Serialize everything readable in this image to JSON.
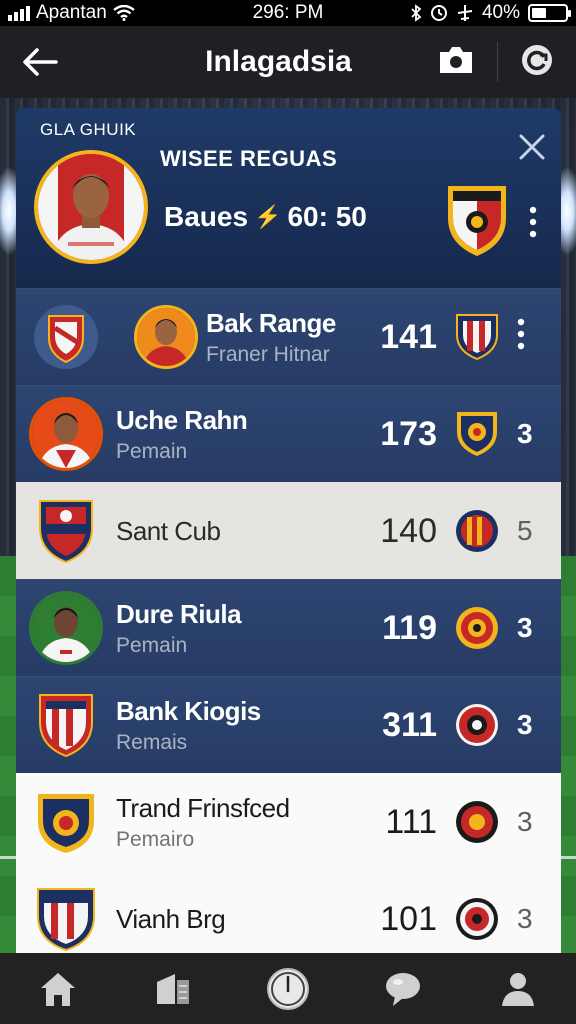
{
  "status_bar": {
    "carrier": "Apantan",
    "time": "296: PM",
    "battery": "40%",
    "battery_level": 0.4
  },
  "header": {
    "title": "Inlagadsia",
    "icons": [
      "back-arrow-icon",
      "camera-icon",
      "refresh-icon"
    ]
  },
  "featured": {
    "section_label": "GLA GHUIK",
    "title": "WISEE REGUAS",
    "score_label": "Baues",
    "score_value": "60: 50",
    "accent": "#f3b51c"
  },
  "rows": [
    {
      "kind": "club+player",
      "name": "Bak Range",
      "sub": "Franer Hitnar",
      "points": "141",
      "rank": "⋮",
      "style": "blue"
    },
    {
      "kind": "player",
      "name": "Uche Rahn",
      "sub": "Pemain",
      "points": "173",
      "rank": "3",
      "style": "blue"
    },
    {
      "kind": "club",
      "name": "Sant Cub",
      "sub": "",
      "points": "140",
      "rank": "5",
      "style": "grey"
    },
    {
      "kind": "player",
      "name": "Dure Riula",
      "sub": "Pemain",
      "points": "119",
      "rank": "3",
      "style": "blue"
    },
    {
      "kind": "club",
      "name": "Bank Kiogis",
      "sub": "Remais",
      "points": "311",
      "rank": "3",
      "style": "blue"
    },
    {
      "kind": "club",
      "name": "Trand Frinsfced",
      "sub": "Pemairo",
      "points": "111",
      "rank": "3",
      "style": "white"
    },
    {
      "kind": "club",
      "name": "Vianh Brg",
      "sub": "",
      "points": "101",
      "rank": "3",
      "style": "white"
    }
  ],
  "bottom_nav": [
    "home-icon",
    "news-icon",
    "clock-icon",
    "chat-icon",
    "profile-icon"
  ],
  "colors": {
    "panel_blue": "#263c66",
    "header_bg": "#1e2024",
    "nav_bg": "#222222",
    "gold": "#f3b51c"
  }
}
